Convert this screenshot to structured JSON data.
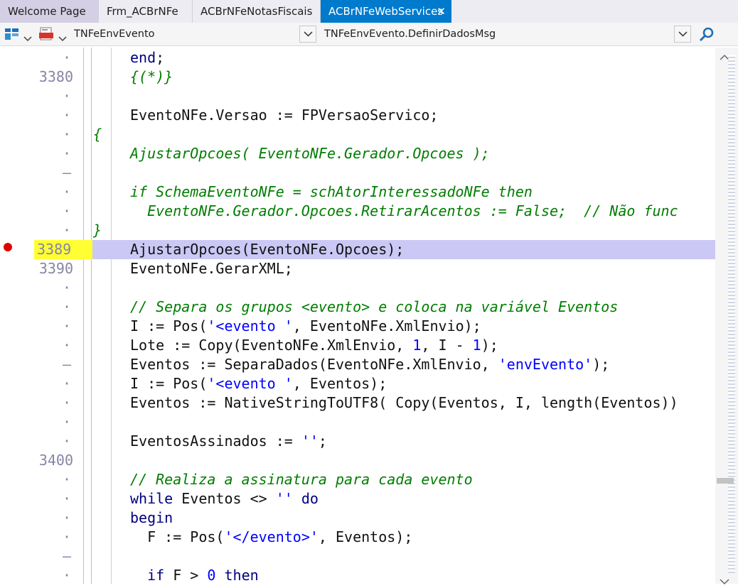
{
  "tabs": [
    {
      "label": "Welcome Page"
    },
    {
      "label": "Frm_ACBrNFe"
    },
    {
      "label": "ACBrNFeNotasFiscais"
    },
    {
      "label": "ACBrNFeWebServices",
      "close": "✕"
    }
  ],
  "toolbar": {
    "class_selector": "TNFeEnvEvento",
    "method_selector": "TNFeEnvEvento.DefinirDadosMsg"
  },
  "editor": {
    "lines": [
      {
        "gutter": "·",
        "html": "<span class=\"kw\">end</span>;",
        "indent": 2
      },
      {
        "gutter": "3380",
        "html": "<span class=\"cm\">{(*)}</span>",
        "indent": 2
      },
      {
        "gutter": "·",
        "html": "",
        "indent": 2
      },
      {
        "gutter": "·",
        "html": "EventoNFe.Versao := FPVersaoServico;",
        "indent": 2
      },
      {
        "gutter": "·",
        "html": "<span class=\"cm\">{</span>",
        "indent": 0
      },
      {
        "gutter": "·",
        "html": "<span class=\"cm\">AjustarOpcoes( EventoNFe.Gerador.Opcoes );</span>",
        "indent": 2
      },
      {
        "gutter": "–",
        "html": "",
        "indent": 2
      },
      {
        "gutter": "·",
        "html": "<span class=\"cm\">if SchemaEventoNFe = schAtorInteressadoNFe then</span>",
        "indent": 2
      },
      {
        "gutter": "·",
        "html": "<span class=\"cm\">  EventoNFe.Gerador.Opcoes.RetirarAcentos := False;  // Não func</span>",
        "indent": 2
      },
      {
        "gutter": "·",
        "html": "<span class=\"cm\">}</span>",
        "indent": 0
      },
      {
        "gutter": "3389",
        "html": "AjustarOpcoes(EventoNFe.Opcoes);",
        "indent": 2,
        "breakpoint": true
      },
      {
        "gutter": "3390",
        "html": "EventoNFe.GerarXML;",
        "indent": 2
      },
      {
        "gutter": "·",
        "html": "",
        "indent": 2
      },
      {
        "gutter": "·",
        "html": "<span class=\"cm\">// Separa os grupos &lt;evento&gt; e coloca na variável Eventos</span>",
        "indent": 2
      },
      {
        "gutter": "·",
        "html": "I := Pos(<span class=\"str\">'&lt;evento '</span>, EventoNFe.XmlEnvio);",
        "indent": 2
      },
      {
        "gutter": "·",
        "html": "Lote := Copy(EventoNFe.XmlEnvio, <span class=\"num\">1</span>, I - <span class=\"num\">1</span>);",
        "indent": 2
      },
      {
        "gutter": "–",
        "html": "Eventos := SeparaDados(EventoNFe.XmlEnvio, <span class=\"str\">'envEvento'</span>);",
        "indent": 2
      },
      {
        "gutter": "·",
        "html": "I := Pos(<span class=\"str\">'&lt;evento '</span>, Eventos);",
        "indent": 2
      },
      {
        "gutter": "·",
        "html": "Eventos := NativeStringToUTF8( Copy(Eventos, I, length(Eventos))",
        "indent": 2
      },
      {
        "gutter": "·",
        "html": "",
        "indent": 2
      },
      {
        "gutter": "·",
        "html": "EventosAssinados := <span class=\"str\">''</span>;",
        "indent": 2
      },
      {
        "gutter": "3400",
        "html": "",
        "indent": 2
      },
      {
        "gutter": "·",
        "html": "<span class=\"cm\">// Realiza a assinatura para cada evento</span>",
        "indent": 2
      },
      {
        "gutter": "·",
        "html": "<span class=\"kw\">while</span> Eventos &lt;&gt; <span class=\"str\">''</span> <span class=\"kw\">do</span>",
        "indent": 2
      },
      {
        "gutter": "·",
        "html": "<span class=\"kw\">begin</span>",
        "indent": 2
      },
      {
        "gutter": "·",
        "html": "  F := Pos(<span class=\"str\">'&lt;/evento&gt;'</span>, Eventos);",
        "indent": 2
      },
      {
        "gutter": "–",
        "html": "",
        "indent": 2
      },
      {
        "gutter": "·",
        "html": "  <span class=\"kw\">if</span> F &gt; <span class=\"num\">0</span> <span class=\"kw\">then</span>",
        "indent": 2
      }
    ]
  },
  "colors": {
    "accent": "#007acc",
    "highlight": "#cbc8f5",
    "breakpoint": "#e00000",
    "breakpoint_ln": "#ffff33"
  },
  "icons": [
    "structure-view-icon",
    "chevron-down-icon",
    "file-icon",
    "search-icon",
    "breakpoint-icon",
    "scroll-up-icon",
    "scroll-down-icon"
  ]
}
